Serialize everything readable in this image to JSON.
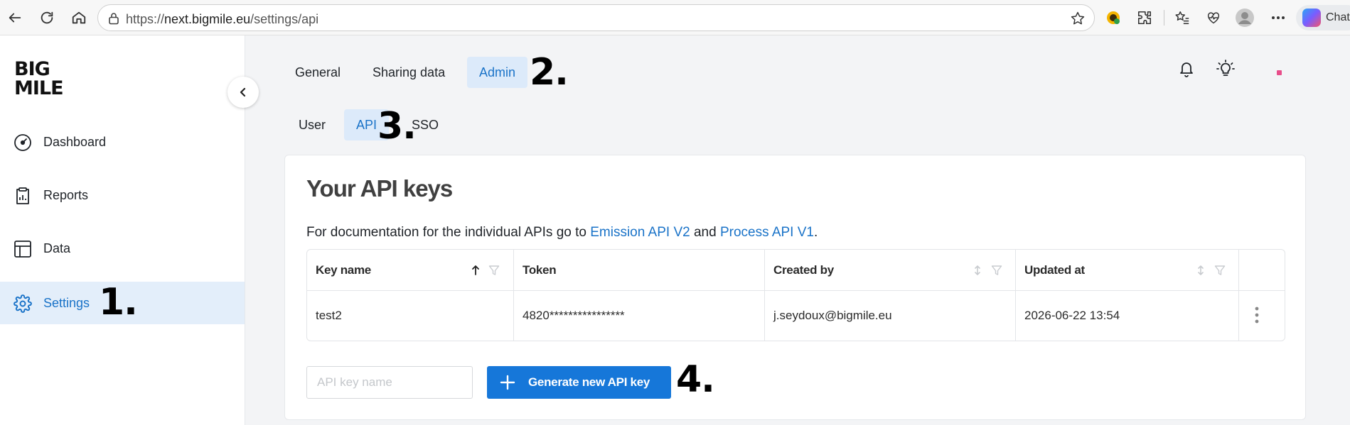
{
  "browser": {
    "url_prefix": "https://",
    "url_domain": "next.bigmile.eu",
    "url_path": "/settings/api",
    "chat_label": "Chat"
  },
  "brand": {
    "logo_line1": "BIG",
    "logo_line2": "MILE",
    "accent": "#1a73c8",
    "button_color": "#1677d9"
  },
  "sidebar": {
    "items": [
      {
        "label": "Dashboard",
        "icon": "gauge-icon"
      },
      {
        "label": "Reports",
        "icon": "clipboard-chart-icon"
      },
      {
        "label": "Data",
        "icon": "table-icon"
      },
      {
        "label": "Settings",
        "icon": "gear-icon",
        "active": true
      }
    ]
  },
  "annotations": {
    "a1": "1.",
    "a2": "2.",
    "a3": "3.",
    "a4": "4."
  },
  "tabs": [
    {
      "label": "General"
    },
    {
      "label": "Sharing data"
    },
    {
      "label": "Admin",
      "active": true
    }
  ],
  "subtabs": [
    {
      "label": "User"
    },
    {
      "label": "API",
      "active": true
    },
    {
      "label": "SSO"
    }
  ],
  "card": {
    "title": "Your API keys",
    "desc_prefix": "For documentation for the individual APIs go to ",
    "link1": "Emission API V2",
    "desc_mid": " and ",
    "link2": "Process API V1",
    "desc_suffix": "."
  },
  "table": {
    "headers": [
      "Key name",
      "Token",
      "Created by",
      "Updated at"
    ],
    "rows": [
      {
        "key_name": "test2",
        "token": "4820****************",
        "created_by": "j.seydoux@bigmile.eu",
        "updated_at": "2026-06-22 13:54"
      }
    ]
  },
  "form": {
    "input_placeholder": "API key name",
    "input_value": "",
    "generate_label": "Generate new API key"
  }
}
